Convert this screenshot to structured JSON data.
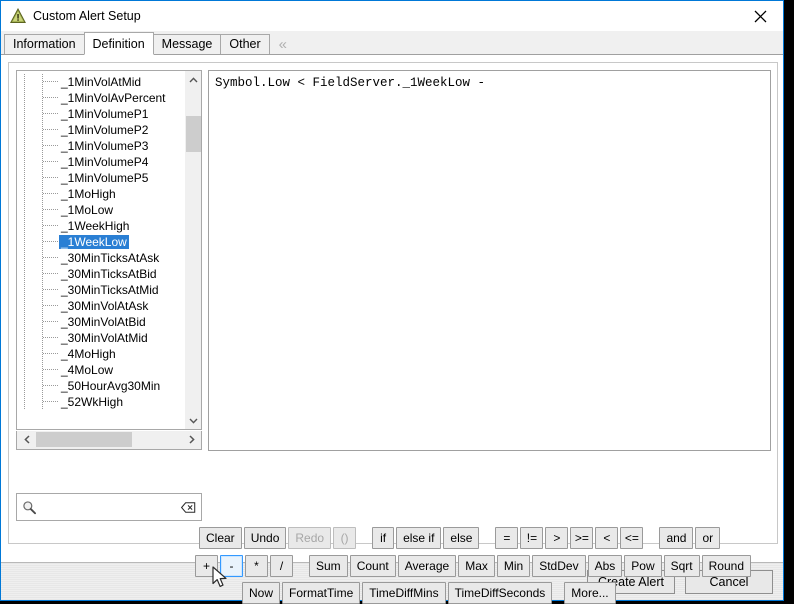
{
  "window": {
    "title": "Custom Alert Setup",
    "icon": "warning-triangle-icon",
    "close_label": "✕",
    "accent_color": "#0078d7"
  },
  "tabs": {
    "items": [
      {
        "label": "Information",
        "active": false
      },
      {
        "label": "Definition",
        "active": true
      },
      {
        "label": "Message",
        "active": false
      },
      {
        "label": "Other",
        "active": false
      }
    ],
    "overflow_icon": "double-chevron-left-icon"
  },
  "tree": {
    "items": [
      {
        "label": "_1MinVolAtMid",
        "selected": false
      },
      {
        "label": "_1MinVolAvPercent",
        "selected": false
      },
      {
        "label": "_1MinVolumeP1",
        "selected": false
      },
      {
        "label": "_1MinVolumeP2",
        "selected": false
      },
      {
        "label": "_1MinVolumeP3",
        "selected": false
      },
      {
        "label": "_1MinVolumeP4",
        "selected": false
      },
      {
        "label": "_1MinVolumeP5",
        "selected": false
      },
      {
        "label": "_1MoHigh",
        "selected": false
      },
      {
        "label": "_1MoLow",
        "selected": false
      },
      {
        "label": "_1WeekHigh",
        "selected": false
      },
      {
        "label": "_1WeekLow",
        "selected": true
      },
      {
        "label": "_30MinTicksAtAsk",
        "selected": false
      },
      {
        "label": "_30MinTicksAtBid",
        "selected": false
      },
      {
        "label": "_30MinTicksAtMid",
        "selected": false
      },
      {
        "label": "_30MinVolAtAsk",
        "selected": false
      },
      {
        "label": "_30MinVolAtBid",
        "selected": false
      },
      {
        "label": "_30MinVolAtMid",
        "selected": false
      },
      {
        "label": "_4MoHigh",
        "selected": false
      },
      {
        "label": "_4MoLow",
        "selected": false
      },
      {
        "label": "_50HourAvg30Min",
        "selected": false
      },
      {
        "label": "_52WkHigh",
        "selected": false
      }
    ],
    "selection_color": "#2a7fd4",
    "vscroll": {
      "up_icon": "chevron-up-icon",
      "down_icon": "chevron-down-icon"
    },
    "hscroll": {
      "left_icon": "chevron-left-icon",
      "right_icon": "chevron-right-icon"
    }
  },
  "search": {
    "icon": "magnifier-icon",
    "clear_icon": "backspace-clear-icon",
    "value": "",
    "placeholder": ""
  },
  "expression": {
    "text": "Symbol.Low < FieldServer._1WeekLow -"
  },
  "toolbar": {
    "row1": [
      {
        "label": "Clear",
        "state": "enabled"
      },
      {
        "label": "Undo",
        "state": "enabled"
      },
      {
        "label": "Redo",
        "state": "disabled"
      },
      {
        "label": "()",
        "state": "disabled"
      },
      {
        "label": "if",
        "state": "enabled"
      },
      {
        "label": "else if",
        "state": "enabled"
      },
      {
        "label": "else",
        "state": "enabled"
      },
      {
        "label": "=",
        "state": "enabled"
      },
      {
        "label": "!=",
        "state": "enabled"
      },
      {
        "label": ">",
        "state": "enabled"
      },
      {
        "label": ">=",
        "state": "enabled"
      },
      {
        "label": "<",
        "state": "enabled"
      },
      {
        "label": "<=",
        "state": "enabled"
      },
      {
        "label": "and",
        "state": "enabled"
      },
      {
        "label": "or",
        "state": "enabled"
      }
    ],
    "row2": [
      {
        "label": "+",
        "state": "enabled"
      },
      {
        "label": "-",
        "state": "focused"
      },
      {
        "label": "*",
        "state": "enabled"
      },
      {
        "label": "/",
        "state": "enabled"
      },
      {
        "label": "Sum",
        "state": "enabled"
      },
      {
        "label": "Count",
        "state": "enabled"
      },
      {
        "label": "Average",
        "state": "enabled"
      },
      {
        "label": "Max",
        "state": "enabled"
      },
      {
        "label": "Min",
        "state": "enabled"
      },
      {
        "label": "StdDev",
        "state": "enabled"
      },
      {
        "label": "Abs",
        "state": "enabled"
      },
      {
        "label": "Pow",
        "state": "enabled"
      },
      {
        "label": "Sqrt",
        "state": "enabled"
      },
      {
        "label": "Round",
        "state": "enabled"
      }
    ],
    "row3": [
      {
        "label": "Now",
        "state": "enabled"
      },
      {
        "label": "FormatTime",
        "state": "enabled"
      },
      {
        "label": "TimeDiffMins",
        "state": "enabled"
      },
      {
        "label": "TimeDiffSeconds",
        "state": "enabled"
      },
      {
        "label": "More...",
        "state": "enabled"
      }
    ]
  },
  "footer": {
    "create_label": "Create Alert",
    "cancel_label": "Cancel"
  }
}
